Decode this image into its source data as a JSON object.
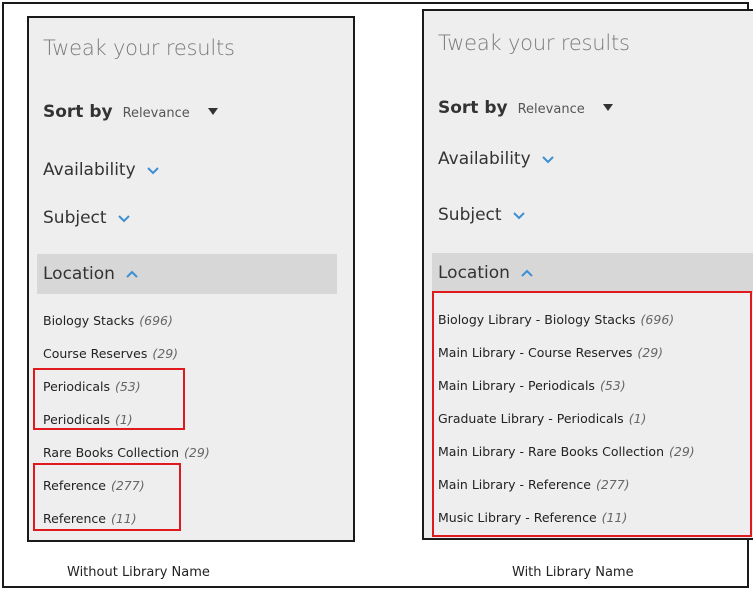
{
  "left": {
    "title": "Tweak your results",
    "sort_label": "Sort by",
    "sort_value": "Relevance",
    "facets": [
      "Availability",
      "Subject"
    ],
    "location_label": "Location",
    "locations": [
      {
        "name": "Biology Stacks",
        "count": "(696)"
      },
      {
        "name": "Course Reserves",
        "count": "(29)"
      },
      {
        "name": "Periodicals",
        "count": "(53)"
      },
      {
        "name": "Periodicals",
        "count": "(1)"
      },
      {
        "name": "Rare Books Collection",
        "count": "(29)"
      },
      {
        "name": "Reference",
        "count": "(277)"
      },
      {
        "name": "Reference",
        "count": "(11)"
      }
    ],
    "caption": "Without Library Name"
  },
  "right": {
    "title": "Tweak your results",
    "sort_label": "Sort by",
    "sort_value": "Relevance",
    "facets": [
      "Availability",
      "Subject"
    ],
    "location_label": "Location",
    "locations": [
      {
        "name": "Biology Library - Biology Stacks",
        "count": "(696)"
      },
      {
        "name": "Main Library - Course Reserves",
        "count": "(29)"
      },
      {
        "name": "Main Library - Periodicals",
        "count": "(53)"
      },
      {
        "name": "Graduate Library - Periodicals",
        "count": "(1)"
      },
      {
        "name": "Main Library - Rare Books Collection",
        "count": "(29)"
      },
      {
        "name": "Main Library - Reference",
        "count": "(277)"
      },
      {
        "name": "Music Library - Reference",
        "count": "(11)"
      }
    ],
    "caption": "With Library Name"
  },
  "icons": {
    "sort_caret": "caret-down-icon",
    "facet_collapsed": "chevron-down-icon",
    "facet_expanded": "chevron-up-icon"
  },
  "colors": {
    "panel_bg": "#eeeeee",
    "location_header_bg": "#d7d7d7",
    "highlight_border": "#e0191f",
    "chevron": "#3d8fd1"
  }
}
